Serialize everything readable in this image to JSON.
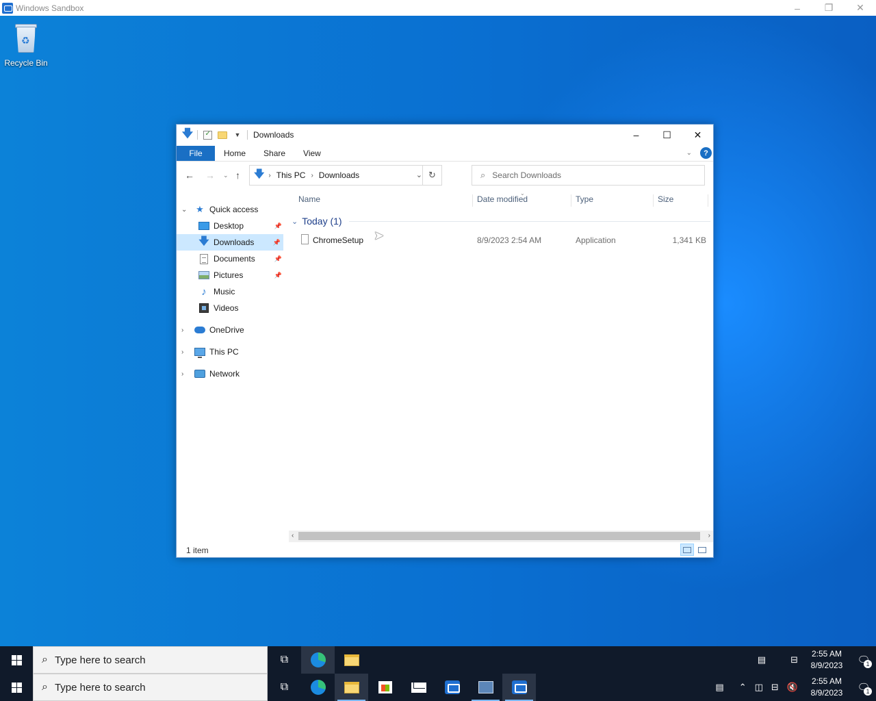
{
  "host": {
    "title": "Windows Sandbox",
    "controls": {
      "minimize": "–",
      "restore": "❐",
      "close": "✕"
    }
  },
  "desktop": {
    "icons": [
      {
        "label": "Recycle Bin",
        "icon": "recycle-bin-icon"
      }
    ]
  },
  "explorer": {
    "title": "Downloads",
    "controls": {
      "minimize": "–",
      "maximize": "☐",
      "close": "✕"
    },
    "ribbon_tabs": [
      "File",
      "Home",
      "Share",
      "View"
    ],
    "address": {
      "crumbs": [
        "This PC",
        "Downloads"
      ]
    },
    "search": {
      "placeholder": "Search Downloads"
    },
    "nav": {
      "quick_access": "Quick access",
      "pinned": [
        "Desktop",
        "Downloads",
        "Documents",
        "Pictures"
      ],
      "unpinned": [
        "Music",
        "Videos"
      ],
      "onedrive": "OneDrive",
      "this_pc": "This PC",
      "network": "Network",
      "selected": "Downloads"
    },
    "columns": [
      "Name",
      "Date modified",
      "Type",
      "Size"
    ],
    "group": "Today (1)",
    "files": [
      {
        "name": "ChromeSetup",
        "date": "8/9/2023 2:54 AM",
        "type": "Application",
        "size": "1,341 KB"
      }
    ],
    "status": "1 item"
  },
  "taskbar": {
    "search_placeholder": "Type here to search",
    "time": "2:55 AM",
    "date": "8/9/2023",
    "notification_count": "1"
  },
  "colors": {
    "accent": "#1a6fc4",
    "selection": "#cce8ff",
    "taskbar": "#101a2a",
    "desktop": "#0a6fd1"
  }
}
